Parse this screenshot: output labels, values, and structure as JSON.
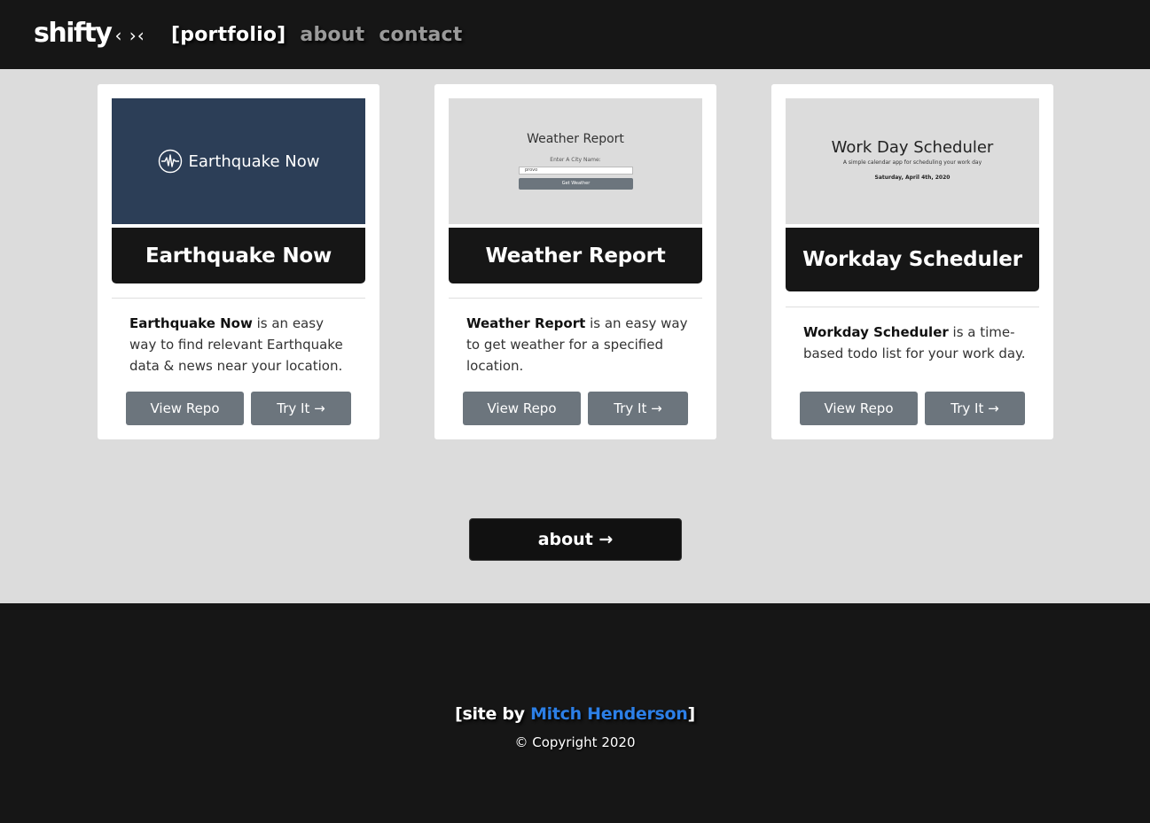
{
  "nav": {
    "brand": "shifty",
    "brand_icon": "‹ ›‹",
    "links": [
      {
        "label": "[portfolio]",
        "active": true
      },
      {
        "label": "about",
        "active": false
      },
      {
        "label": "contact",
        "active": false
      }
    ]
  },
  "cards": [
    {
      "thumb_text": "Earthquake Now",
      "title": "Earthquake Now",
      "desc_bold": "Earthquake Now",
      "desc_rest": " is an easy way to find relevant Earthquake data & news near your location.",
      "repo_label": "View Repo",
      "try_label": "Try It →"
    },
    {
      "thumb_title": "Weather Report",
      "thumb_label": "Enter A City Name:",
      "thumb_input": "provo",
      "thumb_button": "Get Weather",
      "title": "Weather Report",
      "desc_bold": "Weather Report",
      "desc_rest": " is an easy way to get weather for a specified location.",
      "repo_label": "View Repo",
      "try_label": "Try It →"
    },
    {
      "thumb_title": "Work Day Scheduler",
      "thumb_sub": "A simple calendar app for scheduling your work day",
      "thumb_date": "Saturday, April 4th, 2020",
      "title": "Workday Scheduler",
      "desc_bold": "Workday Scheduler",
      "desc_rest": " is a time-based todo list for your work day.",
      "repo_label": "View Repo",
      "try_label": "Try It →"
    }
  ],
  "about_button": "about →",
  "footer": {
    "credit_prefix": "[site by ",
    "credit_name": "Mitch Henderson",
    "credit_suffix": "]",
    "copyright": "© Copyright 2020"
  },
  "colors": {
    "nav_bg": "#161616",
    "page_bg": "#dcdcdc",
    "button_gray": "#6c757d",
    "link_blue": "#2c7fe6"
  }
}
